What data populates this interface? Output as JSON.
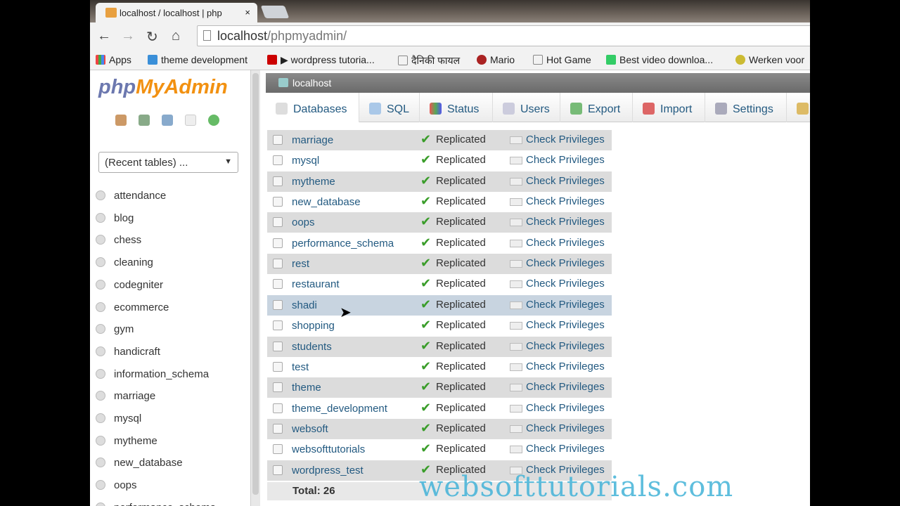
{
  "browser": {
    "tab_title": "localhost / localhost | php",
    "tab_close": "×",
    "favicon": "PMA",
    "url_host": "localhost",
    "url_path": "/phpmyadmin/"
  },
  "bookmarks": [
    "Apps",
    "theme development",
    "▶ wordpress tutoria...",
    "दैनिकी फायल",
    "Mario",
    "Hot Game",
    "Best video downloa...",
    "Werken voor"
  ],
  "nav": {
    "logo_php": "php",
    "logo_myadmin": "MyAdmin",
    "recent": "(Recent tables) ...",
    "databases": [
      "attendance",
      "blog",
      "chess",
      "cleaning",
      "codegniter",
      "ecommerce",
      "gym",
      "handicraft",
      "information_schema",
      "marriage",
      "mysql",
      "mytheme",
      "new_database",
      "oops",
      "performance_schema"
    ]
  },
  "main": {
    "breadcrumb": "localhost",
    "tabs": [
      "Databases",
      "SQL",
      "Status",
      "Users",
      "Export",
      "Import",
      "Settings"
    ],
    "rows": [
      {
        "name": "marriage",
        "status": "Replicated",
        "action": "Check Privileges"
      },
      {
        "name": "mysql",
        "status": "Replicated",
        "action": "Check Privileges"
      },
      {
        "name": "mytheme",
        "status": "Replicated",
        "action": "Check Privileges"
      },
      {
        "name": "new_database",
        "status": "Replicated",
        "action": "Check Privileges"
      },
      {
        "name": "oops",
        "status": "Replicated",
        "action": "Check Privileges"
      },
      {
        "name": "performance_schema",
        "status": "Replicated",
        "action": "Check Privileges"
      },
      {
        "name": "rest",
        "status": "Replicated",
        "action": "Check Privileges"
      },
      {
        "name": "restaurant",
        "status": "Replicated",
        "action": "Check Privileges"
      },
      {
        "name": "shadi",
        "status": "Replicated",
        "action": "Check Privileges"
      },
      {
        "name": "shopping",
        "status": "Replicated",
        "action": "Check Privileges"
      },
      {
        "name": "students",
        "status": "Replicated",
        "action": "Check Privileges"
      },
      {
        "name": "test",
        "status": "Replicated",
        "action": "Check Privileges"
      },
      {
        "name": "theme",
        "status": "Replicated",
        "action": "Check Privileges"
      },
      {
        "name": "theme_development",
        "status": "Replicated",
        "action": "Check Privileges"
      },
      {
        "name": "websoft",
        "status": "Replicated",
        "action": "Check Privileges"
      },
      {
        "name": "websofttutorials",
        "status": "Replicated",
        "action": "Check Privileges"
      },
      {
        "name": "wordpress_test",
        "status": "Replicated",
        "action": "Check Privileges"
      }
    ],
    "total": "Total: 26"
  },
  "watermark": "websofttutorials.com"
}
